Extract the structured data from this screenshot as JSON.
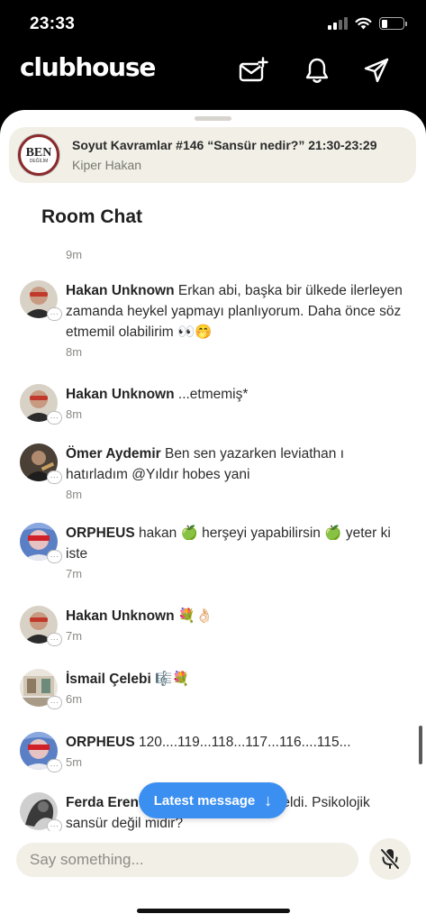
{
  "status": {
    "time": "23:33"
  },
  "app": {
    "logo": "clubhouse",
    "icons": [
      "compose-message-icon",
      "bell-icon",
      "paper-plane-icon"
    ]
  },
  "room": {
    "avatar_text": "BEN",
    "avatar_subtext": "DEĞİLİM",
    "title": "Soyut Kavramlar #146 “Sansür nedir?” 21:30-23:29",
    "host": "Kiper Hakan"
  },
  "chat": {
    "heading": "Room Chat",
    "top_time": "9m",
    "messages": [
      {
        "name": "Hakan Unknown",
        "text": " Erkan abi, başka bir ülkede ilerleyen zamanda heykel yapmayı planlıyorum. Daha önce söz etmemil olabilirim 👀🤭",
        "time": "8m"
      },
      {
        "name": "Hakan Unknown",
        "text": " ...etmemiş*",
        "time": "8m"
      },
      {
        "name": "Ömer Aydemir",
        "text": " Ben sen yazarken leviathan ı hatırladım @Yıldır hobes yani",
        "time": "8m"
      },
      {
        "name": "ORPHEUS",
        "text": " hakan 🍏 herşeyi yapabilirsin 🍏 yeter ki iste",
        "time": "7m"
      },
      {
        "name": "Hakan Unknown",
        "text": " 💐👌🏻",
        "time": "7m"
      },
      {
        "name": "İsmail Çelebi",
        "text": " 🎼💐",
        "time": "6m"
      },
      {
        "name": "ORPHEUS",
        "text": " 120....119...118...117...116....115...",
        "time": "5m"
      },
      {
        "name": "Ferda Eren",
        "text": " Hier Bahçesi tablosu geldi. Psikolojik sansür değil midir?",
        "time": ""
      }
    ]
  },
  "fab": {
    "label": "Latest message",
    "arrow": "↓"
  },
  "input": {
    "placeholder": "Say something..."
  },
  "colors": {
    "accent": "#3b8ff0",
    "banner": "#f1efe6"
  }
}
